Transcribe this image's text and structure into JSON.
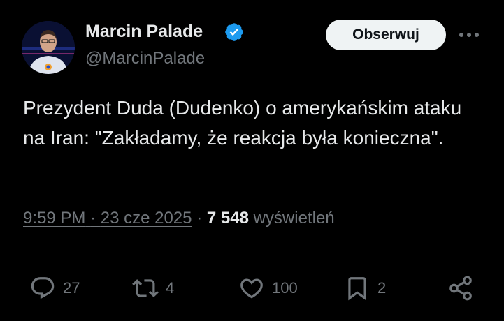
{
  "author": {
    "display_name": "Marcin Palade",
    "handle": "@MarcinPalade",
    "verified": true
  },
  "follow_label": "Obserwuj",
  "tweet": {
    "text": "Prezydent Duda (Dudenko) o amerykańskim ataku na Iran: \"Zakładamy, że reakcja była konieczna\"."
  },
  "meta": {
    "time": "9:59 PM",
    "separator": "·",
    "date": "23 cze 2025",
    "views_count": "7 548",
    "views_label": "wyświetleń"
  },
  "actions": {
    "replies": "27",
    "reposts": "4",
    "likes": "100",
    "bookmarks": "2"
  },
  "icons": [
    "verified-badge-icon",
    "more-icon",
    "reply-icon",
    "repost-icon",
    "like-icon",
    "bookmark-icon",
    "share-icon"
  ],
  "colors": {
    "background": "#000000",
    "primary_text": "#e7e9ea",
    "secondary_text": "#71767b",
    "verified_blue": "#1d9bf0",
    "divider": "#2f3336",
    "follow_button_bg": "#eff3f4"
  }
}
